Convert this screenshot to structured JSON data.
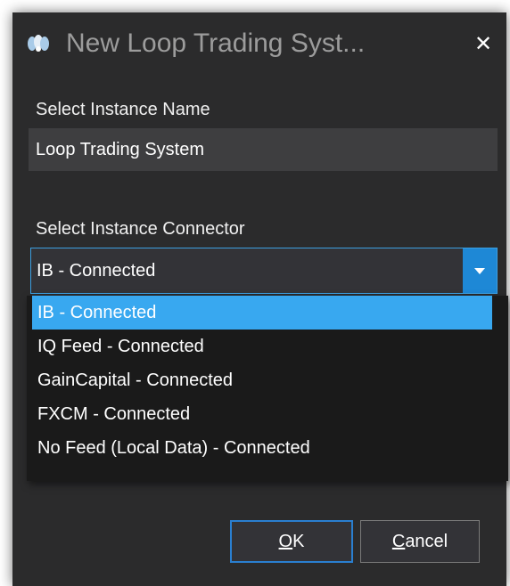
{
  "window": {
    "title": "New Loop Trading Syst...",
    "close_glyph": "✕",
    "app_icon": "app-logo-icon",
    "accent": "#1e88d6",
    "background": "#2b2b2c"
  },
  "instance_name": {
    "label": "Select Instance Name",
    "value": "Loop Trading System"
  },
  "connector": {
    "label": "Select Instance Connector",
    "selected": "IB - Connected",
    "options": [
      "IB - Connected",
      "IQ Feed - Connected",
      "GainCapital - Connected",
      "FXCM - Connected",
      "No Feed (Local Data) - Connected"
    ],
    "highlight": "#38a8f0"
  },
  "buttons": {
    "ok_mnemonic": "O",
    "ok_rest": "K",
    "cancel_mnemonic": "C",
    "cancel_rest": "ancel"
  }
}
